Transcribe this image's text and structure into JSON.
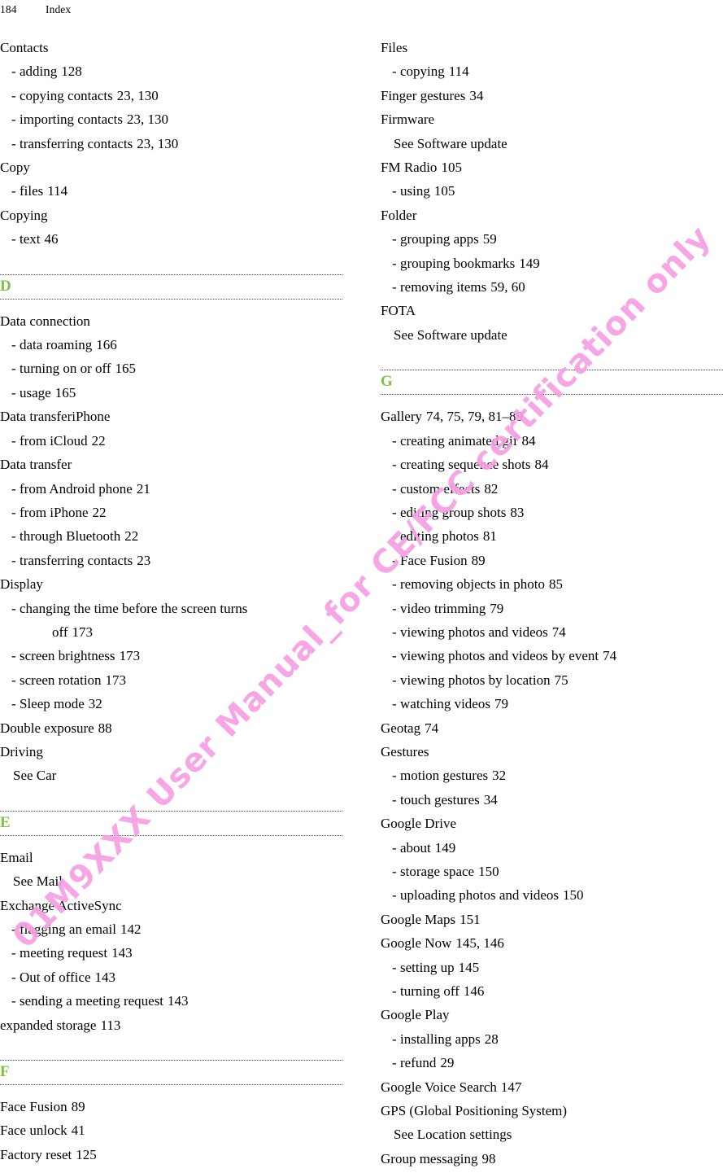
{
  "header": {
    "page_number": "184",
    "section": "Index"
  },
  "watermark": {
    "text": "01M9XXX User Manual_for CE/FCC certification only",
    "color": "#f79fe3"
  },
  "colors": {
    "letter_heading": "#7dc242",
    "text": "#000000",
    "rule": "#4a4a4a"
  },
  "left_column": [
    {
      "kind": "entry",
      "label": "Contacts",
      "pages": ""
    },
    {
      "kind": "sub",
      "label": "adding",
      "pages": "128"
    },
    {
      "kind": "sub",
      "label": "copying contacts",
      "pages": "23, 130"
    },
    {
      "kind": "sub",
      "label": "importing contacts",
      "pages": "23, 130"
    },
    {
      "kind": "sub",
      "label": "transferring contacts",
      "pages": "23, 130"
    },
    {
      "kind": "entry",
      "label": "Copy",
      "pages": ""
    },
    {
      "kind": "sub",
      "label": "files",
      "pages": "114"
    },
    {
      "kind": "entry",
      "label": "Copying",
      "pages": ""
    },
    {
      "kind": "sub",
      "label": "text",
      "pages": "46"
    },
    {
      "kind": "letter",
      "letter": "D"
    },
    {
      "kind": "entry",
      "label": "Data connection",
      "pages": ""
    },
    {
      "kind": "sub",
      "label": "data roaming",
      "pages": "166"
    },
    {
      "kind": "sub",
      "label": "turning on or off",
      "pages": "165"
    },
    {
      "kind": "sub",
      "label": "usage",
      "pages": "165"
    },
    {
      "kind": "entry",
      "label": "Data transferiPhone",
      "pages": ""
    },
    {
      "kind": "sub",
      "label": "from iCloud",
      "pages": "22"
    },
    {
      "kind": "entry",
      "label": "Data transfer",
      "pages": ""
    },
    {
      "kind": "sub",
      "label": "from Android phone",
      "pages": "21"
    },
    {
      "kind": "sub",
      "label": "from iPhone",
      "pages": "22"
    },
    {
      "kind": "sub",
      "label": "through Bluetooth",
      "pages": "22"
    },
    {
      "kind": "sub",
      "label": "transferring contacts",
      "pages": "23"
    },
    {
      "kind": "entry",
      "label": "Display",
      "pages": ""
    },
    {
      "kind": "wrap",
      "label": "changing the time before the screen turns",
      "continuation": "off",
      "pages": "173"
    },
    {
      "kind": "sub",
      "label": "screen brightness",
      "pages": "173"
    },
    {
      "kind": "sub",
      "label": "screen rotation",
      "pages": "173"
    },
    {
      "kind": "sub",
      "label": "Sleep mode",
      "pages": "32"
    },
    {
      "kind": "entry",
      "label": "Double exposure",
      "pages": "88"
    },
    {
      "kind": "entry",
      "label": "Driving",
      "pages": ""
    },
    {
      "kind": "xref",
      "label": "See Car"
    },
    {
      "kind": "letter",
      "letter": "E"
    },
    {
      "kind": "entry",
      "label": "Email",
      "pages": ""
    },
    {
      "kind": "xref",
      "label": "See Mail"
    },
    {
      "kind": "entry",
      "label": "Exchange ActiveSync",
      "pages": ""
    },
    {
      "kind": "sub",
      "label": "flagging an email",
      "pages": "142"
    },
    {
      "kind": "sub",
      "label": "meeting request",
      "pages": "143"
    },
    {
      "kind": "sub",
      "label": "Out of office",
      "pages": "143"
    },
    {
      "kind": "sub",
      "label": "sending a meeting request",
      "pages": "143"
    },
    {
      "kind": "entry",
      "label": "expanded storage",
      "pages": "113"
    },
    {
      "kind": "letter",
      "letter": "F"
    },
    {
      "kind": "entry",
      "label": "Face Fusion",
      "pages": "89"
    },
    {
      "kind": "entry",
      "label": "Face unlock",
      "pages": "41"
    },
    {
      "kind": "entry",
      "label": "Factory reset",
      "pages": "125"
    }
  ],
  "right_column": [
    {
      "kind": "entry",
      "label": "Files",
      "pages": ""
    },
    {
      "kind": "sub",
      "label": "copying",
      "pages": "114"
    },
    {
      "kind": "entry",
      "label": "Finger gestures",
      "pages": "34"
    },
    {
      "kind": "entry",
      "label": "Firmware",
      "pages": ""
    },
    {
      "kind": "xref",
      "label": "See Software update"
    },
    {
      "kind": "entry",
      "label": "FM Radio",
      "pages": "105"
    },
    {
      "kind": "sub",
      "label": "using",
      "pages": "105"
    },
    {
      "kind": "entry",
      "label": "Folder",
      "pages": ""
    },
    {
      "kind": "sub",
      "label": "grouping apps",
      "pages": "59"
    },
    {
      "kind": "sub",
      "label": "grouping bookmarks",
      "pages": "149"
    },
    {
      "kind": "sub",
      "label": "removing items",
      "pages": "59, 60"
    },
    {
      "kind": "entry",
      "label": "FOTA",
      "pages": ""
    },
    {
      "kind": "xref",
      "label": "See Software update"
    },
    {
      "kind": "letter",
      "letter": "G"
    },
    {
      "kind": "entry",
      "label": "Gallery",
      "pages": "74, 75, 79, 81–89"
    },
    {
      "kind": "sub",
      "label": "creating animated gif",
      "pages": "84"
    },
    {
      "kind": "sub",
      "label": "creating sequence shots",
      "pages": "84"
    },
    {
      "kind": "sub",
      "label": "custom effects",
      "pages": "82"
    },
    {
      "kind": "sub",
      "label": "editing group shots",
      "pages": "83"
    },
    {
      "kind": "sub",
      "label": "editing photos",
      "pages": "81"
    },
    {
      "kind": "sub",
      "label": "Face Fusion",
      "pages": "89"
    },
    {
      "kind": "sub",
      "label": "removing objects in photo",
      "pages": "85"
    },
    {
      "kind": "sub",
      "label": "video trimming",
      "pages": "79"
    },
    {
      "kind": "sub",
      "label": "viewing photos and videos",
      "pages": "74"
    },
    {
      "kind": "sub",
      "label": "viewing photos and videos by event",
      "pages": "74"
    },
    {
      "kind": "sub",
      "label": "viewing photos by location",
      "pages": "75"
    },
    {
      "kind": "sub",
      "label": "watching videos",
      "pages": "79"
    },
    {
      "kind": "entry",
      "label": "Geotag",
      "pages": "74"
    },
    {
      "kind": "entry",
      "label": "Gestures",
      "pages": ""
    },
    {
      "kind": "sub",
      "label": "motion gestures",
      "pages": "32"
    },
    {
      "kind": "sub",
      "label": "touch gestures",
      "pages": "34"
    },
    {
      "kind": "entry",
      "label": "Google Drive",
      "pages": ""
    },
    {
      "kind": "sub",
      "label": "about",
      "pages": "149"
    },
    {
      "kind": "sub",
      "label": "storage space",
      "pages": "150"
    },
    {
      "kind": "sub",
      "label": "uploading photos and videos",
      "pages": "150"
    },
    {
      "kind": "entry",
      "label": "Google Maps",
      "pages": "151"
    },
    {
      "kind": "entry",
      "label": "Google Now",
      "pages": "145, 146"
    },
    {
      "kind": "sub",
      "label": "setting up",
      "pages": "145"
    },
    {
      "kind": "sub",
      "label": "turning off",
      "pages": "146"
    },
    {
      "kind": "entry",
      "label": "Google Play",
      "pages": ""
    },
    {
      "kind": "sub",
      "label": "installing apps",
      "pages": "28"
    },
    {
      "kind": "sub",
      "label": "refund",
      "pages": "29"
    },
    {
      "kind": "entry",
      "label": "Google Voice Search",
      "pages": "147"
    },
    {
      "kind": "entry",
      "label": "GPS (Global Positioning System)",
      "pages": ""
    },
    {
      "kind": "xref",
      "label": "See Location settings"
    },
    {
      "kind": "entry",
      "label": "Group messaging",
      "pages": "98"
    }
  ]
}
